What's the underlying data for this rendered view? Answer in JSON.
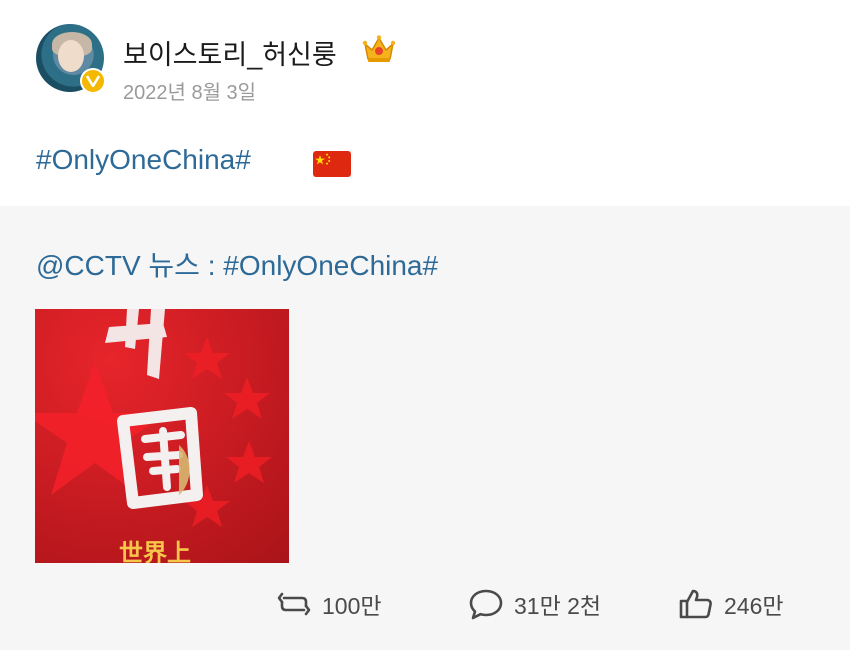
{
  "post": {
    "username": "보이스토리_허신룽",
    "date": "2022년 8월 3일",
    "text": "#OnlyOneChina#",
    "flag_icon": "china-flag-icon",
    "crown_icon": "crown-icon"
  },
  "repost": {
    "text": "@CCTV 뉴스 : #OnlyOneChina#",
    "image_icon": "china-poster-image"
  },
  "actions": {
    "repost_count": "100만",
    "comment_count": "31만 2천",
    "like_count": "246만"
  },
  "colors": {
    "link": "#2e6a97",
    "repost_bg": "#f6f6f6",
    "badge": "#f5b800",
    "flag_red": "#de2910",
    "flag_yellow": "#ffde00"
  }
}
